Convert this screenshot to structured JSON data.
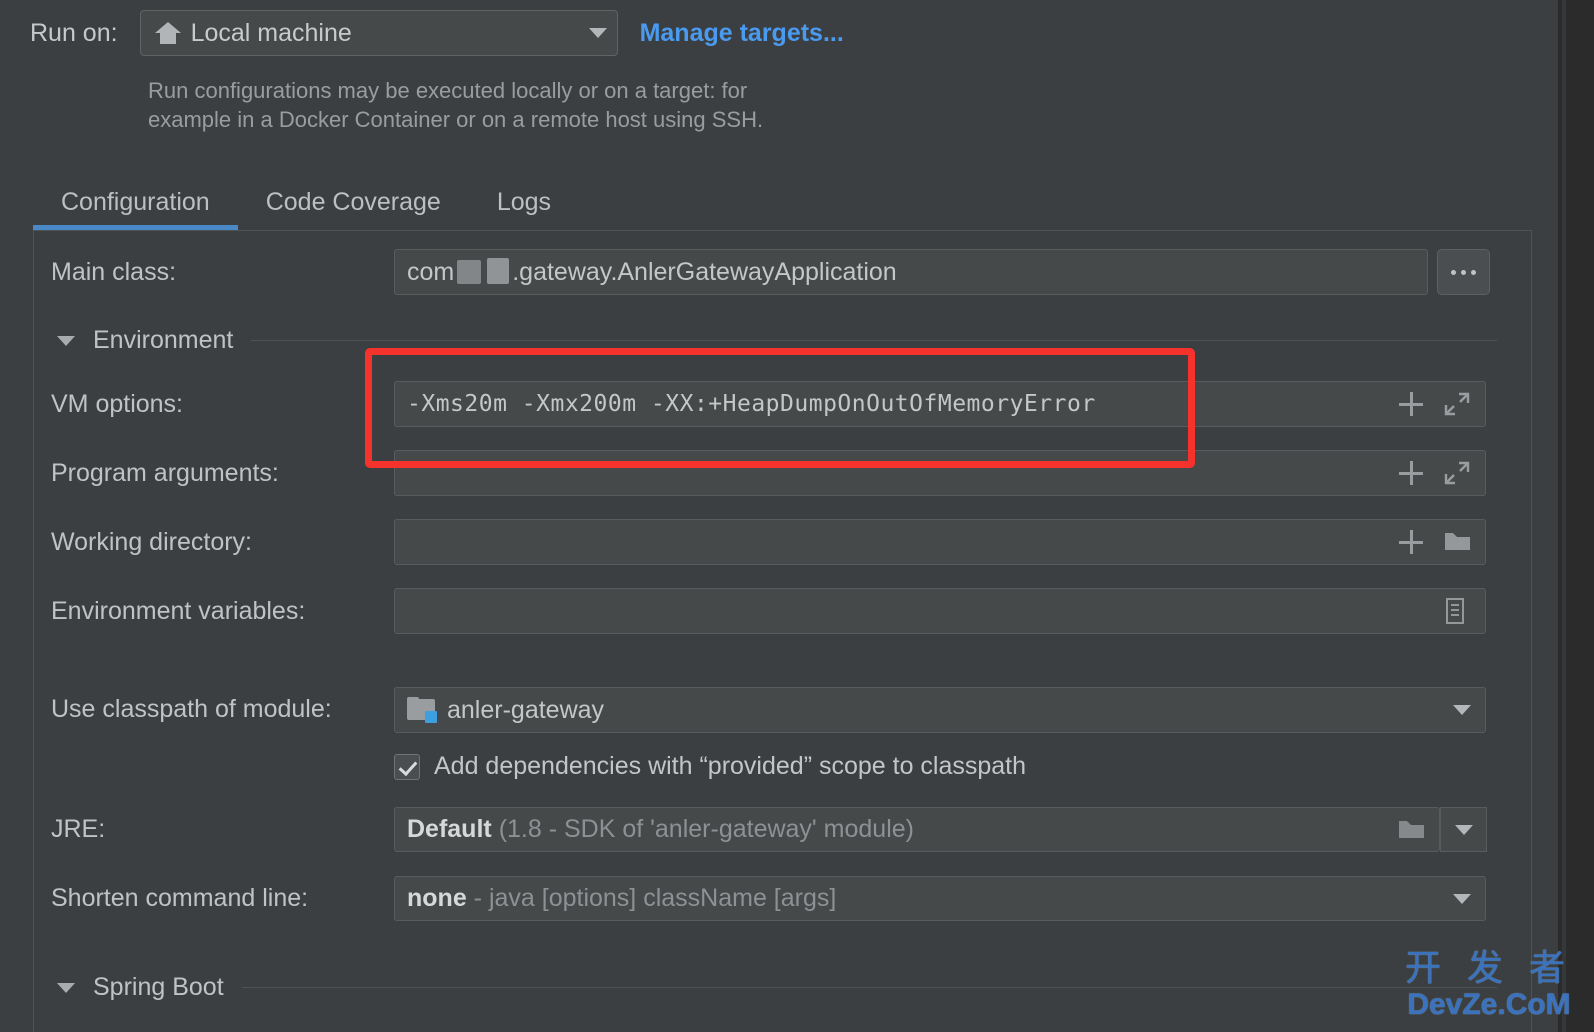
{
  "run_on": {
    "label": "Run on:",
    "selected": "Local machine",
    "icon": "home-icon",
    "manage_link": "Manage targets...",
    "hint_line1": "Run configurations may be executed locally or on a target: for",
    "hint_line2": "example in a Docker Container or on a remote host using SSH."
  },
  "tabs": [
    {
      "label": "Configuration",
      "active": true
    },
    {
      "label": "Code Coverage",
      "active": false
    },
    {
      "label": "Logs",
      "active": false
    }
  ],
  "form": {
    "main_class": {
      "label": "Main class:",
      "value_prefix": "com",
      "value_suffix": ".gateway.AnlerGatewayApplication",
      "browse_label": "..."
    },
    "environment_section": "Environment",
    "vm_options": {
      "label": "VM options:",
      "value": "-Xms20m -Xmx200m -XX:+HeapDumpOnOutOfMemoryError",
      "icons": [
        "plus-icon",
        "expand-icon"
      ]
    },
    "program_arguments": {
      "label": "Program arguments:",
      "value": "",
      "icons": [
        "plus-icon",
        "expand-icon"
      ]
    },
    "working_directory": {
      "label": "Working directory:",
      "value": "",
      "icons": [
        "plus-icon",
        "folder-icon"
      ]
    },
    "environment_variables": {
      "label": "Environment variables:",
      "value": "",
      "icons": [
        "document-icon"
      ]
    },
    "classpath_module": {
      "label": "Use classpath of module:",
      "value": "anler-gateway",
      "icon": "module-folder-icon"
    },
    "add_provided_dependencies": {
      "label": "Add dependencies with “provided” scope to classpath",
      "checked": true
    },
    "jre": {
      "label": "JRE:",
      "value_strong": "Default",
      "value_dim": "(1.8 - SDK of 'anler-gateway' module)",
      "icons": [
        "folder-icon",
        "chevron-down-icon"
      ]
    },
    "shorten_command_line": {
      "label": "Shorten command line:",
      "value_strong": "none",
      "value_dim": "- java [options] className [args]",
      "icons": [
        "chevron-down-icon"
      ]
    },
    "spring_boot_section": "Spring Boot"
  },
  "annotation": {
    "type": "rectangle-highlight",
    "color": "#f5322b",
    "targets": "vm-options-row"
  },
  "watermark": {
    "line1": "开 发 者",
    "line2": "DevZe.CoM",
    "color": "#3a72bd"
  },
  "colors": {
    "background": "#3c3f41",
    "field_background": "#45494a",
    "accent_tab": "#4a88c7",
    "link": "#4a9bf0",
    "badge_blue": "#3d9fe0",
    "annotation_red": "#f5322b"
  }
}
